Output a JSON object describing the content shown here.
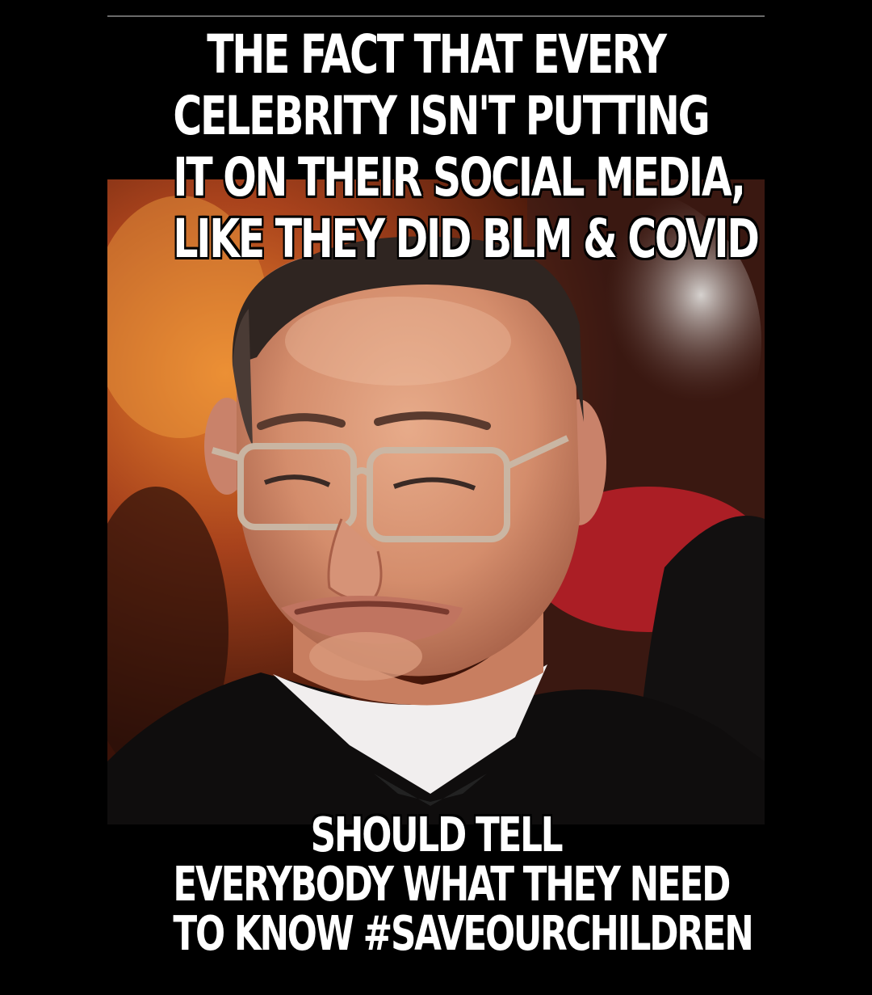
{
  "top_caption": {
    "lines": [
      "THE FACT THAT EVERY",
      "CELEBRITY ISN'T PUTTING",
      "IT ON THEIR SOCIAL MEDIA,",
      "LIKE THEY DID BLM & COVID"
    ]
  },
  "bottom_caption": {
    "lines": [
      "SHOULD TELL",
      "EVERYBODY WHAT THEY NEED",
      "TO KNOW #SAVEOURCHILDREN"
    ]
  },
  "colors": {
    "background": "#000000",
    "text": "#ffffff",
    "text_outline": "#000000",
    "divider": "#6a6a6a"
  }
}
